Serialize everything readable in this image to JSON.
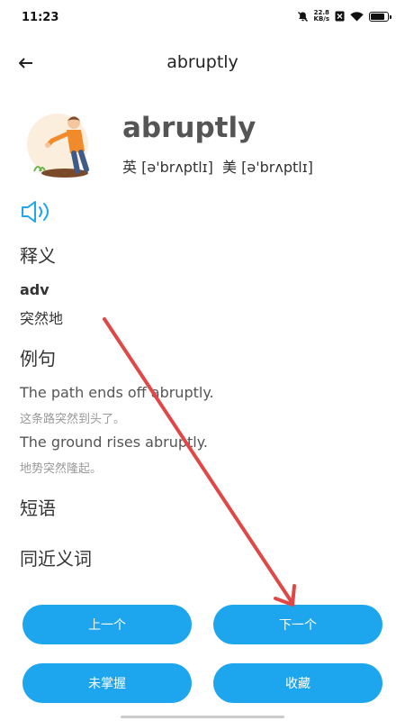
{
  "status_bar": {
    "time": "11:23",
    "net_speed_value": "22.8",
    "net_speed_unit": "KB/s",
    "battery_level": 0.85
  },
  "header": {
    "title": "abruptly"
  },
  "word": {
    "headword": "abruptly",
    "phonetic_uk_label": "英",
    "phonetic_uk": "[ə'brʌptlɪ]",
    "phonetic_us_label": "美",
    "phonetic_us": "[ə'brʌptlɪ]"
  },
  "sections": {
    "meaning_title": "释义",
    "examples_title": "例句",
    "phrases_title": "短语",
    "synonyms_title": "同近义词"
  },
  "definition": {
    "pos": "adv",
    "text": "突然地"
  },
  "examples": [
    {
      "en": "The path ends off abruptly.",
      "zh": "这条路突然到头了。"
    },
    {
      "en": "The ground rises abruptly.",
      "zh": "地势突然隆起。"
    }
  ],
  "buttons": {
    "prev": "上一个",
    "next": "下一个",
    "unknown": "未掌握",
    "favorite": "收藏"
  },
  "colors": {
    "accent": "#1da6ee",
    "annotation_arrow": "#e04848"
  }
}
